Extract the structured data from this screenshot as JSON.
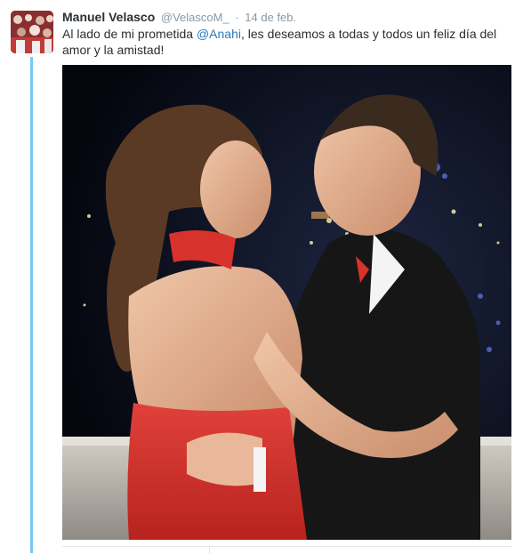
{
  "tweet": {
    "author_name": "Manuel Velasco",
    "author_handle": "@VelascoM_",
    "separator": "·",
    "timestamp": "14 de feb.",
    "text_before": "Al lado de mi prometida ",
    "mention": "@Anahi",
    "text_after": ", les deseamos a todas y todos un feliz día del amor y la amistad!"
  },
  "colors": {
    "mention_link": "#2b7bb9",
    "thread_line": "#77c7f7",
    "dress_red": "#d7322b"
  },
  "icons": {
    "avatar": "profile-photo",
    "photo": "couple-photo"
  }
}
